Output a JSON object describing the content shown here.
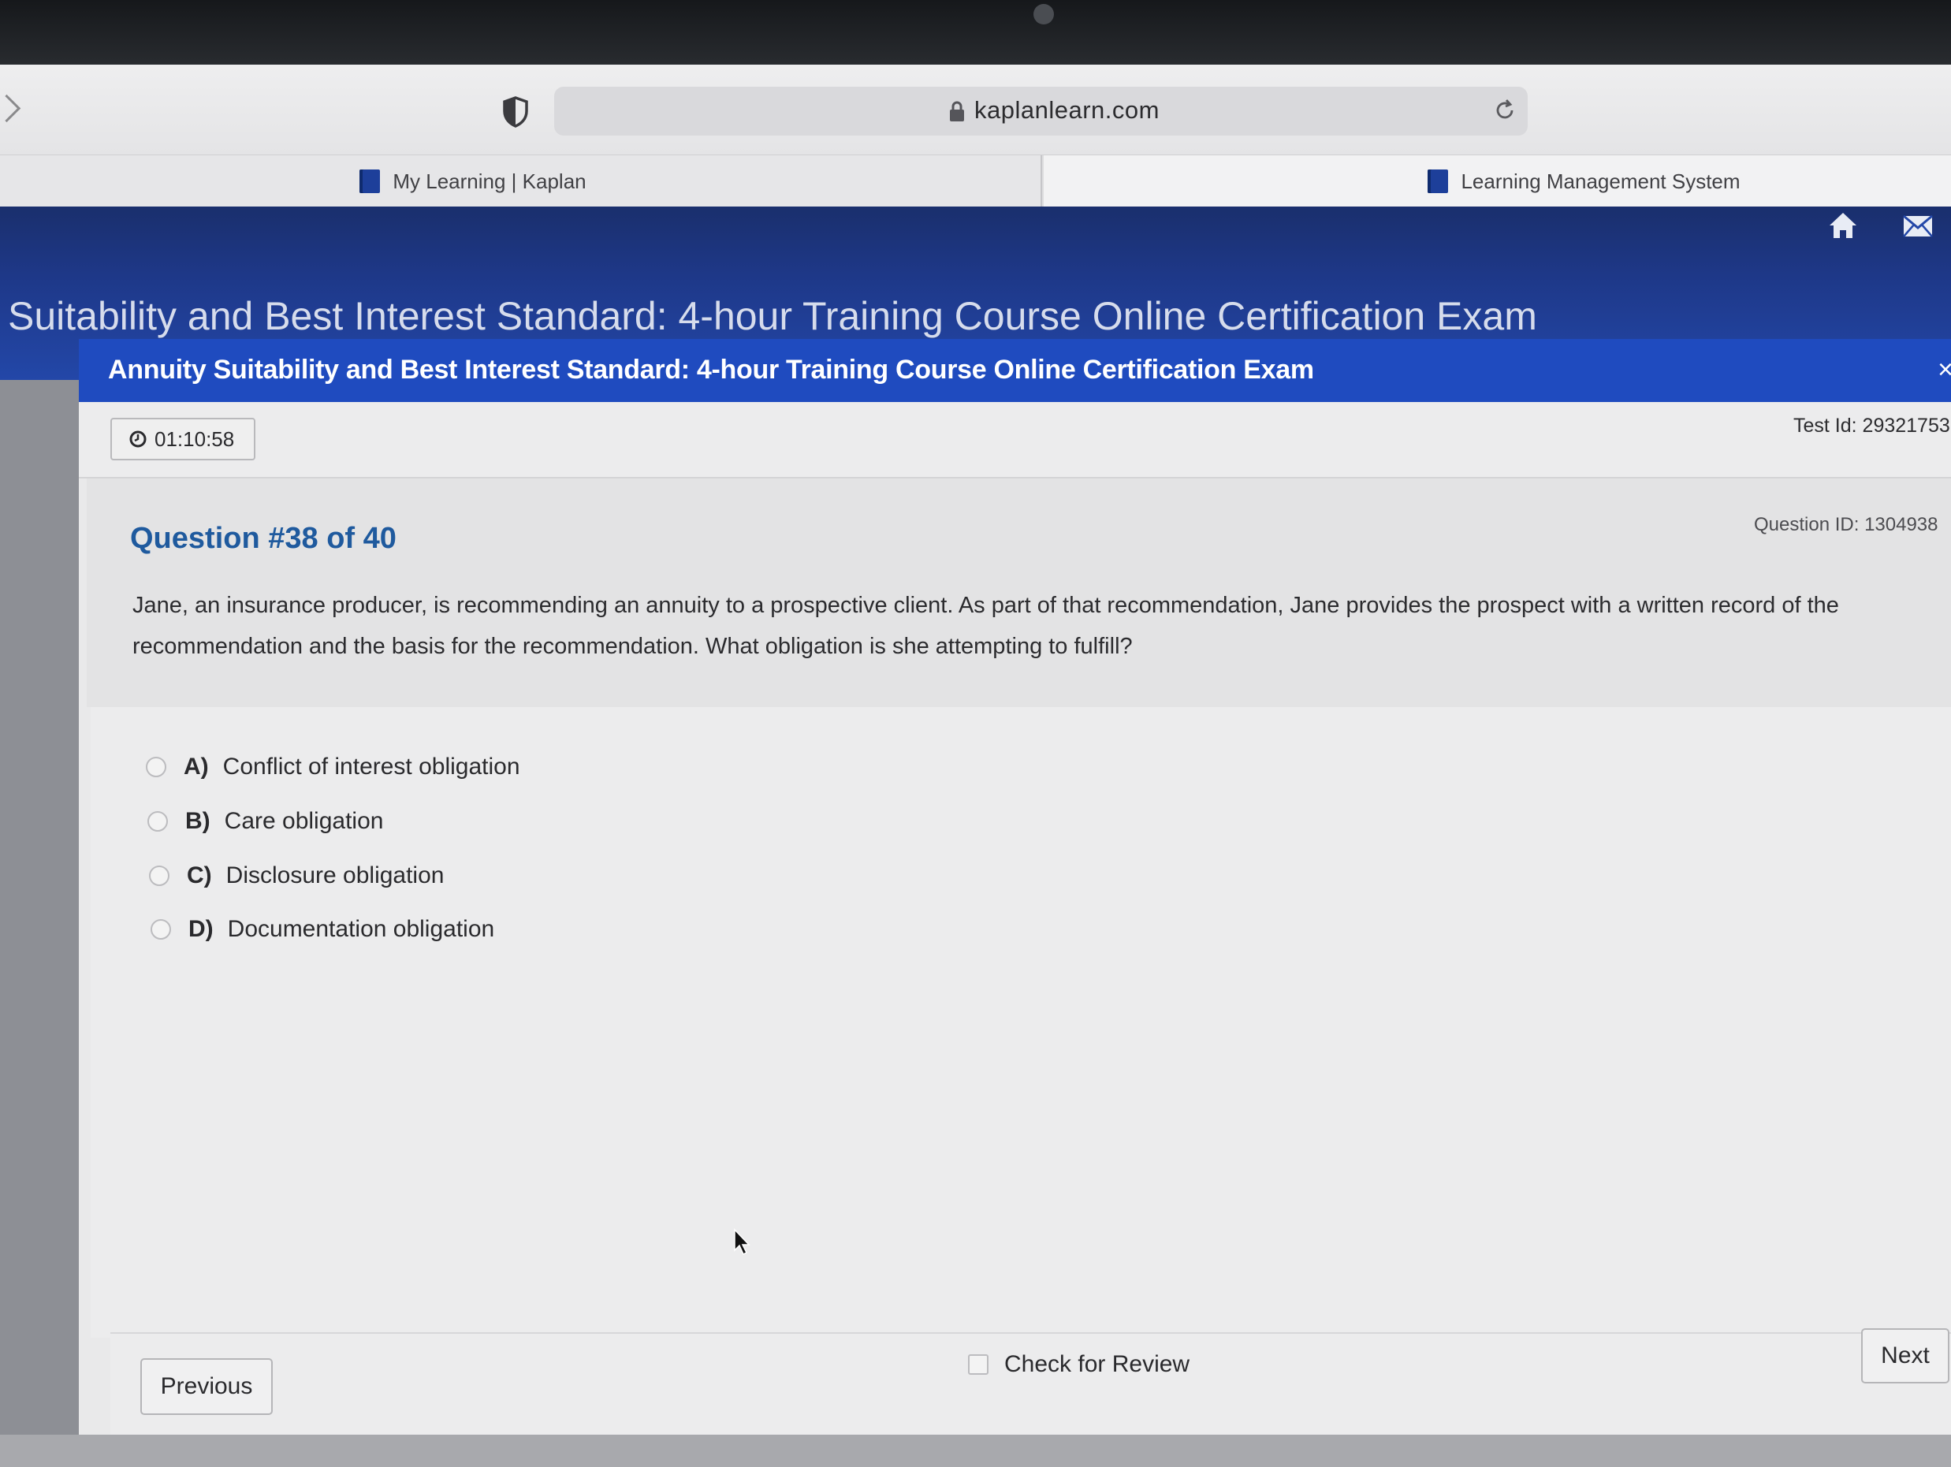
{
  "browser": {
    "url": "kaplanlearn.com",
    "tabs": [
      {
        "label": "My Learning | Kaplan",
        "active": false
      },
      {
        "label": "Learning Management System",
        "active": true
      }
    ]
  },
  "header": {
    "page_title": "Suitability and Best Interest Standard: 4-hour Training Course Online Certification Exam",
    "icons": [
      "home-icon",
      "mail-icon"
    ]
  },
  "exam": {
    "title": "Annuity Suitability and Best Interest Standard: 4-hour Training Course Online Certification Exam",
    "timer": "01:10:58",
    "test_id": "Test Id: 29321753"
  },
  "question": {
    "title": "Question #38 of 40",
    "id_label": "Question ID: 1304938",
    "text": "Jane, an insurance producer, is recommending an annuity to a prospective client. As part of that recommendation, Jane provides the prospect with a written record of the recommendation and the basis for the recommendation. What obligation is she attempting to fulfill?",
    "options": [
      {
        "letter": "A)",
        "label": "Conflict of interest obligation",
        "selected": false
      },
      {
        "letter": "B)",
        "label": "Care obligation",
        "selected": false
      },
      {
        "letter": "C)",
        "label": "Disclosure obligation",
        "selected": false
      },
      {
        "letter": "D)",
        "label": "Documentation obligation",
        "selected": false
      }
    ]
  },
  "footer": {
    "previous_label": "Previous",
    "review_label": "Check for Review",
    "review_checked": false,
    "next_label": "Next"
  },
  "colors": {
    "header_navy": "#1e3888",
    "banner_blue": "#1f4bbf",
    "question_title_blue": "#1f5a9e"
  }
}
